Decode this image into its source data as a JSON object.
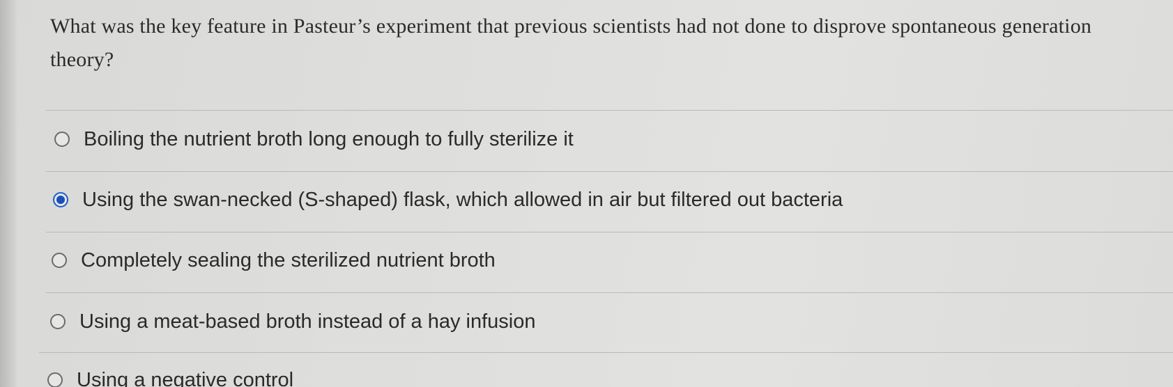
{
  "question": {
    "text": "What was the key feature in Pasteur’s experiment that previous scientists had not done to disprove spontaneous generation theory?"
  },
  "options": [
    {
      "label": "Boiling the nutrient broth long enough to fully sterilize it",
      "selected": false
    },
    {
      "label": "Using the swan-necked (S-shaped) flask, which allowed in air but filtered out bacteria",
      "selected": true
    },
    {
      "label": "Completely sealing the sterilized nutrient broth",
      "selected": false
    },
    {
      "label": "Using a meat-based broth instead of a hay infusion",
      "selected": false
    },
    {
      "label": "Using a negative control",
      "selected": false
    }
  ],
  "colors": {
    "selected_radio": "#1b4fb8",
    "text": "#2a2a2c",
    "background": "#dededc"
  }
}
